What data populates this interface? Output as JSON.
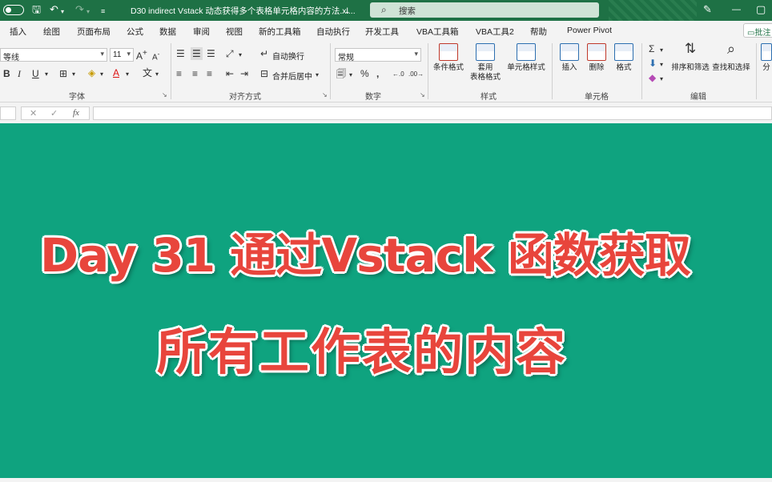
{
  "titlebar": {
    "doc_title": "D30 indirect Vstack 动态获得多个表格单元格内容的方法.xl...",
    "search_label": "搜索"
  },
  "tabs": [
    "插入",
    "绘图",
    "页面布局",
    "公式",
    "数据",
    "审阅",
    "视图",
    "新的工具箱",
    "自动执行",
    "开发工具",
    "VBA工具箱",
    "VBA工具2",
    "帮助",
    "Power Pivot"
  ],
  "comment_button": "批注",
  "ribbon": {
    "font": {
      "name": "等线",
      "size": "11",
      "label": "字体"
    },
    "alignment": {
      "wrap_text": "自动换行",
      "merge_center": "合并后居中",
      "label": "对齐方式"
    },
    "number": {
      "format": "常规",
      "label": "数字"
    },
    "styles": {
      "conditional": "条件格式",
      "table_format_1": "套用",
      "table_format_2": "表格格式",
      "cell_styles": "单元格样式",
      "label": "样式"
    },
    "cells": {
      "insert": "插入",
      "delete": "删除",
      "format": "格式",
      "label": "单元格"
    },
    "editing": {
      "sort_filter": "排序和筛选",
      "find_select": "查找和选择",
      "label": "编辑"
    },
    "partial_right": "分"
  },
  "overlay": {
    "line1": "Day 31 通过Vstack 函数获取",
    "line2": "所有工作表的内容"
  },
  "colors": {
    "title_bar": "#1e7145",
    "overlay": "#0fa37f",
    "headline_text": "#e8453c",
    "headline_outline": "#ffffff"
  }
}
